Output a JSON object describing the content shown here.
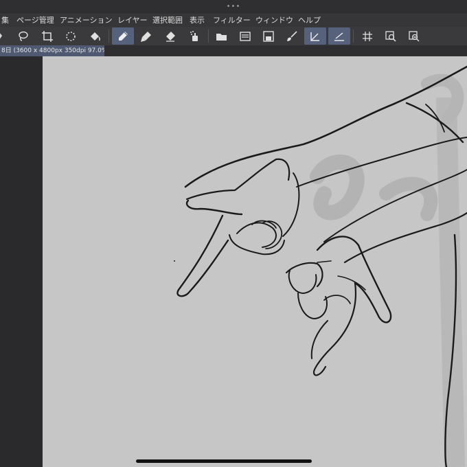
{
  "app": {
    "window_dots": "•••"
  },
  "menu": {
    "items": [
      {
        "label": "集"
      },
      {
        "label": "ページ管理"
      },
      {
        "label": "アニメーション"
      },
      {
        "label": "レイヤー"
      },
      {
        "label": "選択範囲"
      },
      {
        "label": "表示"
      },
      {
        "label": "フィルター"
      },
      {
        "label": "ウィンドウ"
      },
      {
        "label": "ヘルプ"
      }
    ]
  },
  "toolbar": {
    "tools": [
      {
        "icon": "lasso-icon",
        "active": false
      },
      {
        "icon": "crop-transform-icon",
        "active": false
      },
      {
        "icon": "sparkle-select-icon",
        "active": false
      },
      {
        "icon": "fill-bucket-icon",
        "active": false
      },
      {
        "icon": "pen-icon",
        "active": true
      },
      {
        "icon": "marker-icon",
        "active": false
      },
      {
        "icon": "eraser-icon",
        "active": false
      },
      {
        "icon": "airbrush-icon",
        "active": false
      },
      {
        "icon": "open-folder-icon",
        "active": false
      },
      {
        "icon": "layers-icon",
        "active": false
      },
      {
        "icon": "save-icon",
        "active": false
      },
      {
        "icon": "brush-settings-icon",
        "active": false
      },
      {
        "icon": "ruler-snap-icon",
        "active": true
      },
      {
        "icon": "perspective-ruler-icon",
        "active": true
      },
      {
        "icon": "grid-icon",
        "active": false
      },
      {
        "icon": "zoom-fit-icon",
        "active": false
      },
      {
        "icon": "zoom-options-icon",
        "active": false
      }
    ]
  },
  "document": {
    "tab_label": "8日 (3600 x 4800px 350dpi 97.0%)"
  },
  "colors": {
    "active_tool": "#56627c",
    "canvas": "#c6c6c6",
    "ink": "#1a1a1a"
  }
}
